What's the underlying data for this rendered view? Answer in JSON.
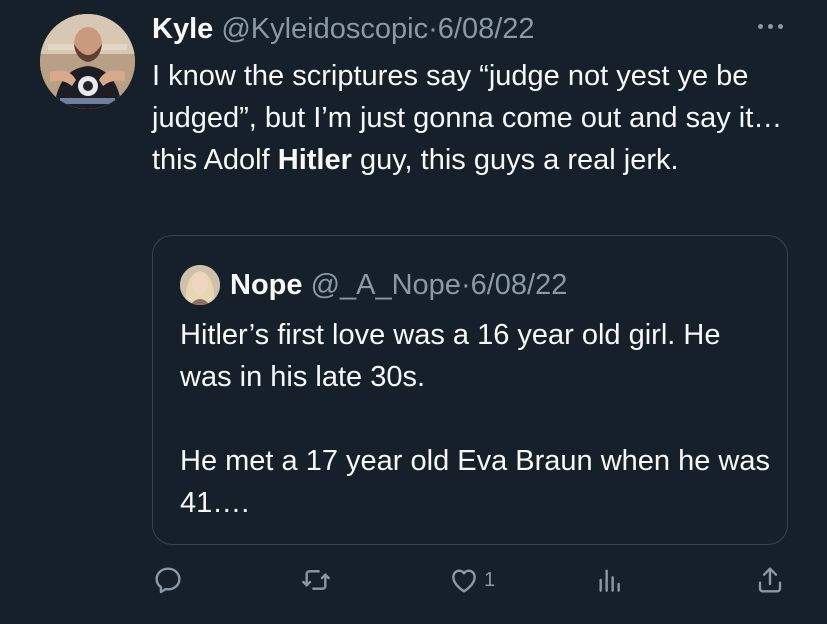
{
  "tweet": {
    "author_name": "Kyle",
    "author_handle": "@Kyleidoscopic",
    "separator": "·",
    "date": "6/08/22",
    "text_before": "I know the scriptures say “judge not yest ye be judged”, but I’m just gonna come out and say it…this Adolf ",
    "text_bold": "Hitler",
    "text_after": " guy, this guys a real jerk."
  },
  "quote": {
    "author_name": "Nope",
    "author_handle": "@_A_Nope",
    "separator": "·",
    "date": "6/08/22",
    "paragraph1": "Hitler’s first love was a 16 year old girl. He was in his late 30s.",
    "paragraph2": "He met a 17 year old Eva Braun when he was 41…."
  },
  "actions": {
    "reply_icon": "reply-icon",
    "retweet_icon": "retweet-icon",
    "like_icon": "heart-icon",
    "like_count": "1",
    "views_icon": "analytics-icon",
    "share_icon": "share-icon"
  },
  "colors": {
    "background": "#15202b",
    "text": "#f7f9f9",
    "muted": "#8b98a5",
    "border": "#38444d"
  }
}
